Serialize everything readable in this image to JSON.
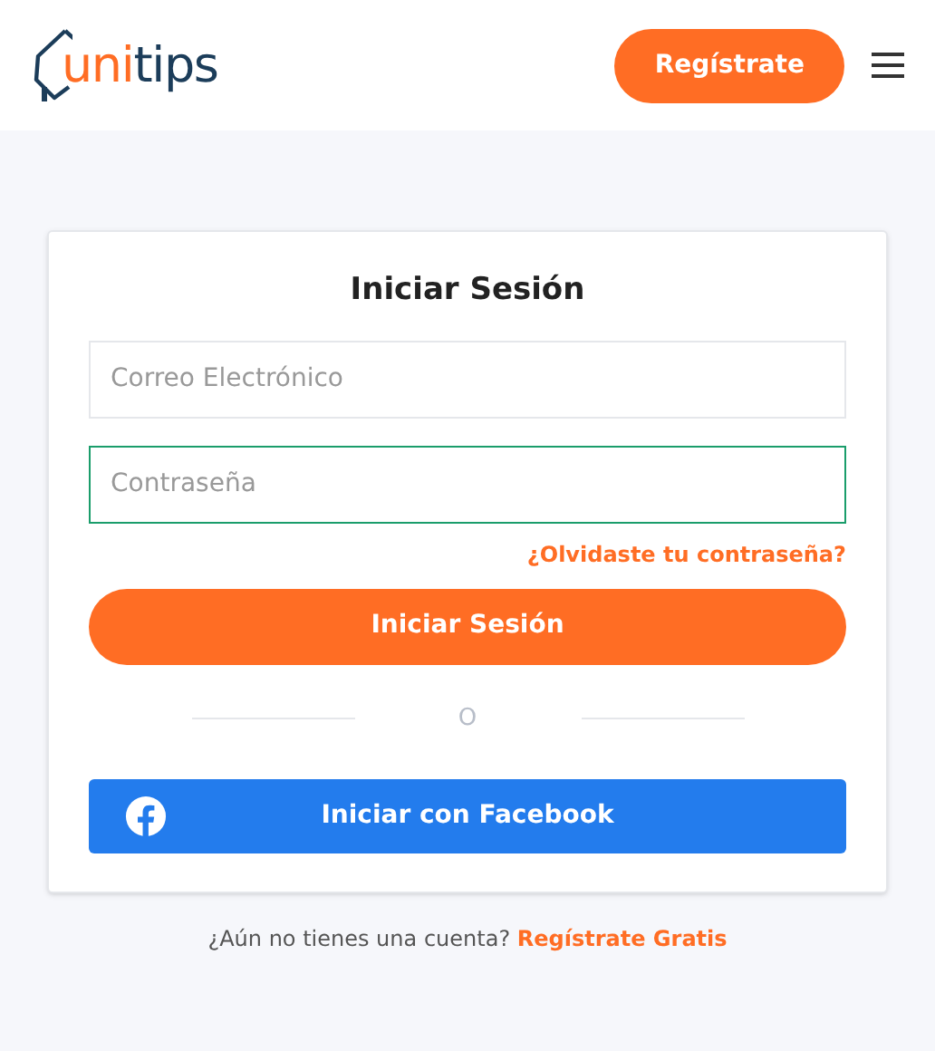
{
  "header": {
    "logo": {
      "accent": "uni",
      "rest": "tips"
    },
    "register_button": "Regístrate"
  },
  "login": {
    "title": "Iniciar Sesión",
    "fields": [
      {
        "placeholder": "Correo Electrónico",
        "focused": false
      },
      {
        "placeholder": "Contraseña",
        "focused": true
      }
    ],
    "forgot_link": "¿Olvidaste tu contraseña?",
    "submit_button": "Iniciar Sesión",
    "divider": "O",
    "facebook_button": "Iniciar con Facebook"
  },
  "footer": {
    "text": "¿Aún no tienes una cuenta?",
    "link": "Regístrate Gratis"
  }
}
